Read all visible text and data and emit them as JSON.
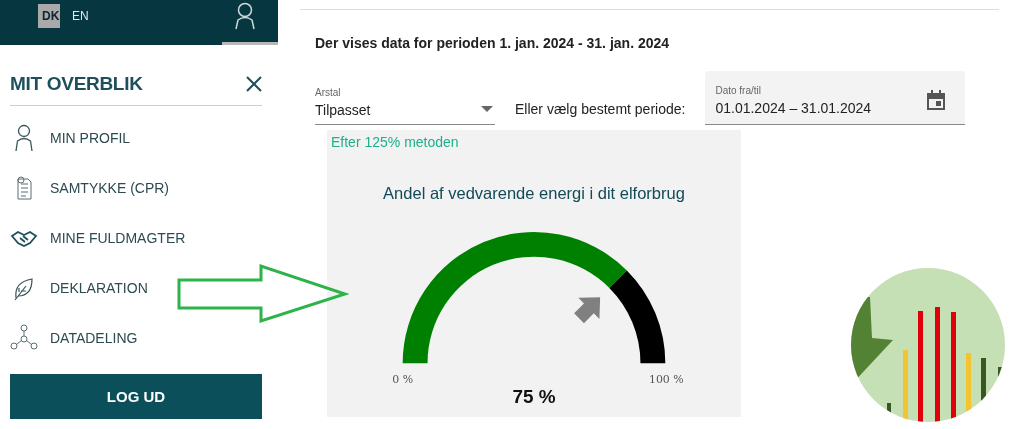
{
  "header": {
    "languages": [
      {
        "label": "DK",
        "selected": true
      },
      {
        "label": "EN",
        "selected": false
      }
    ]
  },
  "menu": {
    "title": "MIT OVERBLIK",
    "items": [
      {
        "label": "MIN PROFIL",
        "kind": "person"
      },
      {
        "label": "SAMTYKKE (CPR)",
        "kind": "document"
      },
      {
        "label": "MINE FULDMAGTER",
        "kind": "handshake"
      },
      {
        "label": "DEKLARATION",
        "kind": "leaf"
      },
      {
        "label": "DATADELING",
        "kind": "network"
      }
    ],
    "logout": "LOG UD"
  },
  "period_text": "Der vises data for perioden 1. jan. 2024 - 31. jan. 2024",
  "filters": {
    "year_select": {
      "label": "Arstal",
      "value": "Tilpasset"
    },
    "period_label": "Eller vælg bestemt periode:",
    "date_field": {
      "label": "Dato fra/til",
      "value": "01.01.2024 – 31.01.2024"
    }
  },
  "gauge": {
    "method": "Efter 125% metoden",
    "title": "Andel af vedvarende energi i dit elforbrug",
    "min_label": "0 %",
    "max_label": "100 %",
    "reading": "75 %"
  }
}
